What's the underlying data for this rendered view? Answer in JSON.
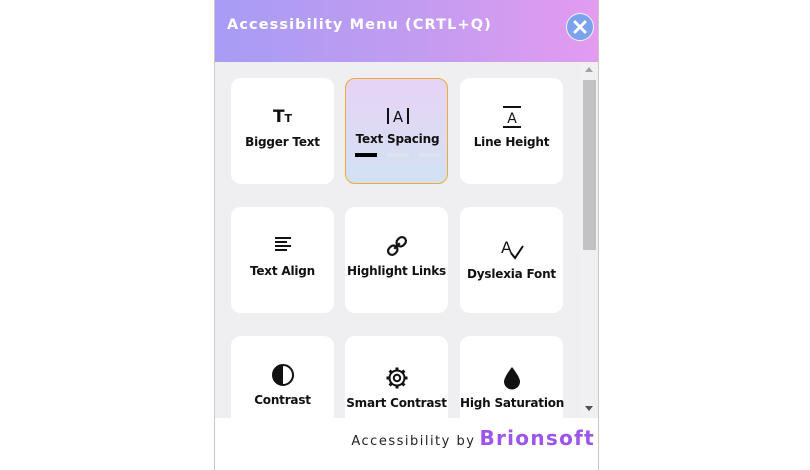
{
  "header": {
    "title": "Accessibility Menu (CRTL+Q)"
  },
  "colors": {
    "header_start": "#a79cf5",
    "header_end": "#e39bf0",
    "close_button": "#7aa3ec",
    "active_border": "#f0a93a",
    "brand": "#9b55ea"
  },
  "cards": [
    {
      "label": "Bigger Text",
      "icon": "bigger-text-icon"
    },
    {
      "label": "Text Spacing",
      "icon": "text-spacing-icon",
      "active": true,
      "level": 1,
      "levels": 3
    },
    {
      "label": "Line Height",
      "icon": "line-height-icon"
    },
    {
      "label": "Text Align",
      "icon": "text-align-icon"
    },
    {
      "label": "Highlight Links",
      "icon": "link-icon"
    },
    {
      "label": "Dyslexia Font",
      "icon": "dyslexia-font-icon"
    },
    {
      "label": "Contrast",
      "icon": "contrast-icon"
    },
    {
      "label": "Smart Contrast",
      "icon": "gear-icon"
    },
    {
      "label": "High Saturation",
      "icon": "droplet-icon"
    }
  ],
  "footer": {
    "prefix": "Accessibility by",
    "brand": "Brionsoft"
  }
}
